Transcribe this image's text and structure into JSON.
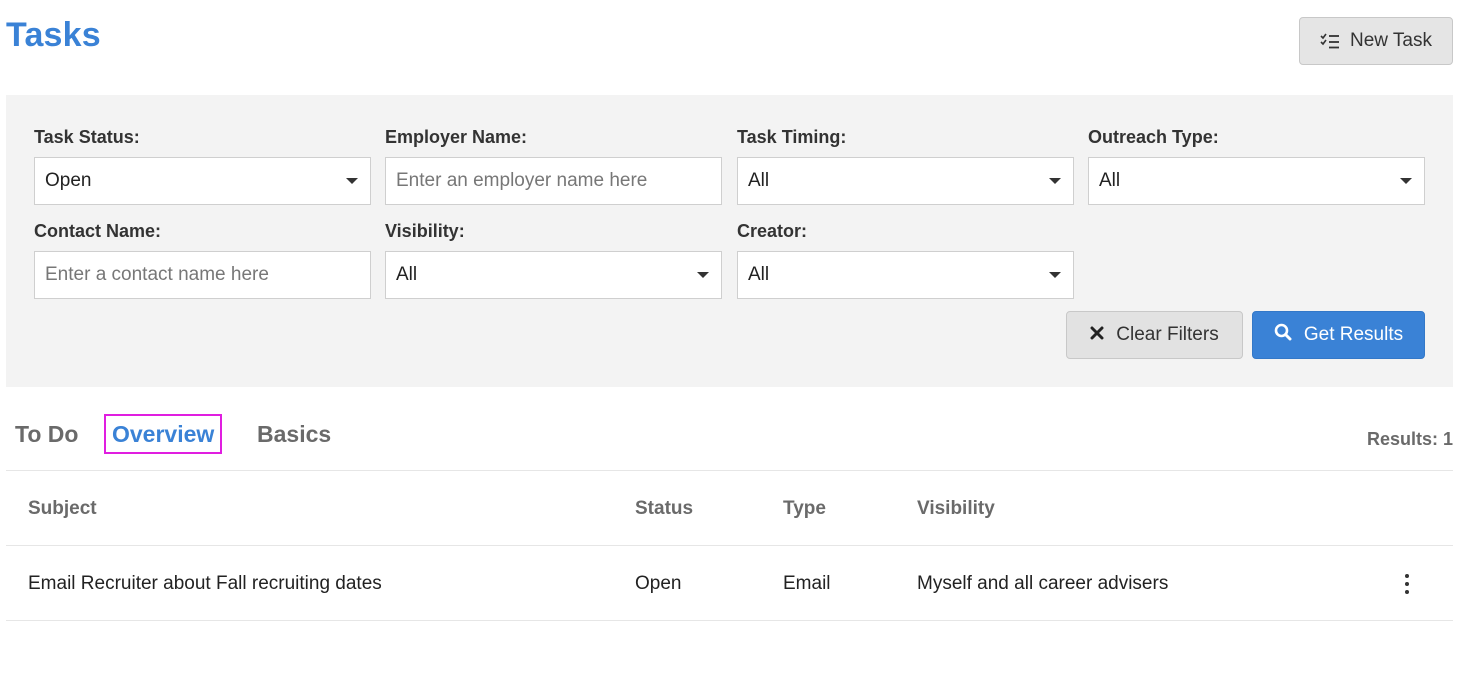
{
  "header": {
    "title": "Tasks",
    "new_task_label": "New Task"
  },
  "filters": {
    "task_status": {
      "label": "Task Status:",
      "value": "Open"
    },
    "employer_name": {
      "label": "Employer Name:",
      "placeholder": "Enter an employer name here"
    },
    "task_timing": {
      "label": "Task Timing:",
      "value": "All"
    },
    "outreach_type": {
      "label": "Outreach Type:",
      "value": "All"
    },
    "contact_name": {
      "label": "Contact Name:",
      "placeholder": "Enter a contact name here"
    },
    "visibility": {
      "label": "Visibility:",
      "value": "All"
    },
    "creator": {
      "label": "Creator:",
      "value": "All"
    },
    "clear_label": "Clear Filters",
    "get_results_label": "Get Results"
  },
  "tabs": [
    {
      "label": "To Do",
      "active": false
    },
    {
      "label": "Overview",
      "active": true
    },
    {
      "label": "Basics",
      "active": false
    }
  ],
  "results_count": "Results: 1",
  "table": {
    "columns": [
      "Subject",
      "Status",
      "Type",
      "Visibility"
    ],
    "rows": [
      {
        "subject": "Email Recruiter about Fall recruiting dates",
        "status": "Open",
        "type": "Email",
        "visibility": "Myself and all career advisers"
      }
    ]
  },
  "icons": {
    "new_task": "task-list-icon",
    "clear": "close-x-icon",
    "search": "search-icon",
    "row_menu": "kebab-menu-icon"
  },
  "colors": {
    "accent": "#3a82d6",
    "panel_bg": "#f3f3f3",
    "tab_highlight": "#e01ee0"
  }
}
